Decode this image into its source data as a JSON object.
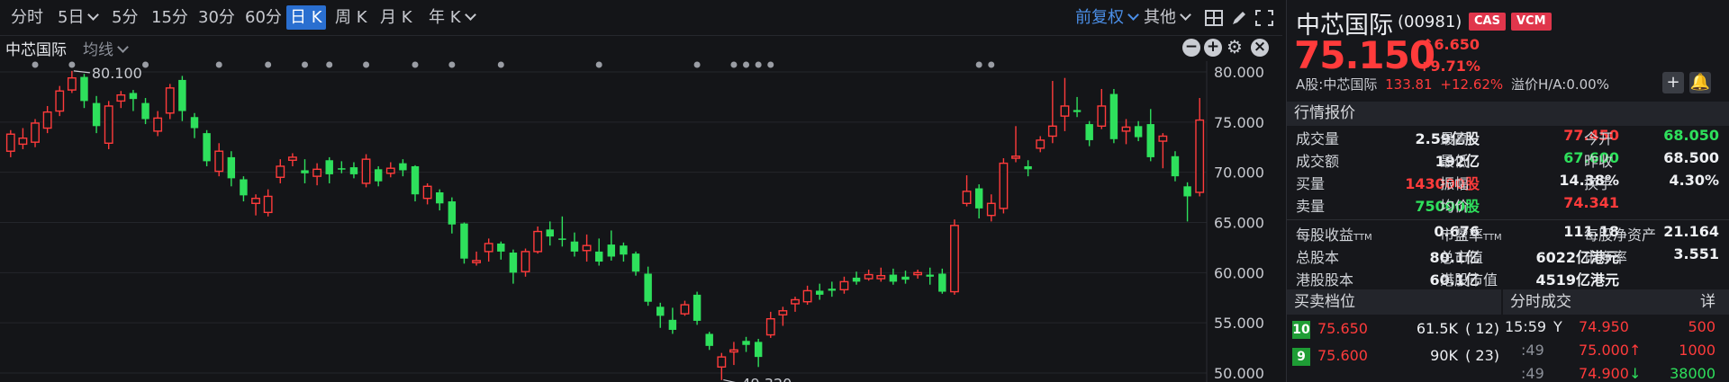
{
  "toolbar": {
    "periods": [
      "分时",
      "5日",
      "5分",
      "15分",
      "30分",
      "60分",
      "日 K",
      "周 K",
      "月 K",
      "年 K"
    ],
    "active_period": "日 K",
    "adjust_label": "前复权",
    "other_label": "其他"
  },
  "subbar": {
    "stock_label": "中芯国际",
    "ma_label": "均线"
  },
  "quote": {
    "name": "中芯国际",
    "code": "(00981)",
    "badges": [
      "CAS",
      "VCM"
    ],
    "price": "75.150",
    "change": "6.650",
    "change_pct": "+9.71%",
    "ashare_label": "A股:中芯国际",
    "ashare_price": "133.81",
    "ashare_pct": "+12.62%",
    "premium_label": "溢价H/A:",
    "premium_value": "0.00%",
    "section_title": "行情报价",
    "stats": [
      {
        "l1": "成交量",
        "v1": "2.59亿股",
        "c1": "white",
        "l2": "最高",
        "v2": "77.450",
        "c2": "red",
        "l3": "今开",
        "v3": "68.050",
        "c3": "green"
      },
      {
        "l1": "成交额",
        "v1": "192亿",
        "c1": "white",
        "l2": "最低",
        "v2": "67.600",
        "c2": "green",
        "l3": "昨收",
        "v3": "68.500",
        "c3": "white"
      },
      {
        "l1": "买量",
        "v1": "143000股",
        "c1": "red",
        "l2": "振幅",
        "v2": "14.38%",
        "c2": "white",
        "l3": "换手",
        "v3": "4.30%",
        "c3": "white"
      },
      {
        "l1": "卖量",
        "v1": "75000股",
        "c1": "green",
        "l2": "均价",
        "v2": "74.341",
        "c2": "red",
        "l3": "",
        "v3": "",
        "c3": "white"
      }
    ],
    "fundamentals": [
      {
        "l1": "每股收益",
        "s1": "TTM",
        "v1": "0.676",
        "l2": "市盈率",
        "s2": "TTM",
        "v2": "111.18",
        "l3": "每股净资产",
        "v3": "21.164"
      },
      {
        "l1": "总股本",
        "s1": "",
        "v1": "80.1亿",
        "l2": "总市值",
        "s2": "",
        "v2": "6022亿港元",
        "l3": "市净率",
        "v3": "3.551"
      },
      {
        "l1": "港股股本",
        "s1": "",
        "v1": "60.1亿",
        "l2": "港股市值",
        "s2": "",
        "v2": "4519亿港元",
        "l3": "",
        "v3": ""
      }
    ]
  },
  "orderbook": {
    "title": "买卖档位",
    "rows": [
      {
        "level": "10",
        "price": "75.650",
        "volume": "61.5K",
        "orders": "( 12)"
      },
      {
        "level": "9",
        "price": "75.600",
        "volume": "90K",
        "orders": "( 23)"
      }
    ]
  },
  "trades": {
    "title": "分时成交",
    "detail_label": "详",
    "rows": [
      {
        "time": "15:59",
        "flag": "Y",
        "price": "74.950",
        "arrow": "",
        "volume": "500",
        "pc": "red",
        "vc": "red"
      },
      {
        "time": ":49",
        "flag": "",
        "price": "75.000",
        "arrow": "↑",
        "volume": "1000",
        "pc": "red",
        "vc": "red"
      },
      {
        "time": ":49",
        "flag": "",
        "price": "74.900",
        "arrow": "↓",
        "volume": "38000",
        "pc": "red",
        "vc": "green"
      }
    ]
  },
  "colors": {
    "up": "#ff3b3b",
    "down": "#2ee05c",
    "accent": "#2a6fd0"
  },
  "chart_data": {
    "type": "candlestick",
    "y_ticks": [
      "80.000",
      "75.000",
      "70.000",
      "65.000",
      "60.000",
      "55.000",
      "50.000"
    ],
    "ylim": [
      49.2,
      80.6
    ],
    "annotations": [
      {
        "label": "80.100",
        "value": 80.1
      },
      {
        "label": "49.320",
        "value": 49.32
      }
    ],
    "candles": [
      [
        72.1,
        73.8,
        74.2,
        71.5
      ],
      [
        72.8,
        73.4,
        74.4,
        72.3
      ],
      [
        73.0,
        74.9,
        75.3,
        72.5
      ],
      [
        74.4,
        76.0,
        76.6,
        73.9
      ],
      [
        76.1,
        78.1,
        78.6,
        75.6
      ],
      [
        78.2,
        79.4,
        80.1,
        77.9
      ],
      [
        79.5,
        77.1,
        79.8,
        76.4
      ],
      [
        76.9,
        74.6,
        77.6,
        73.9
      ],
      [
        72.9,
        76.6,
        77.1,
        72.3
      ],
      [
        77.1,
        77.7,
        78.1,
        76.4
      ],
      [
        77.9,
        77.3,
        78.2,
        76.1
      ],
      [
        76.9,
        75.3,
        77.4,
        74.8
      ],
      [
        74.1,
        75.4,
        76.1,
        73.6
      ],
      [
        75.9,
        78.4,
        78.8,
        75.3
      ],
      [
        79.2,
        76.1,
        79.6,
        75.1
      ],
      [
        75.5,
        74.4,
        75.9,
        73.4
      ],
      [
        73.9,
        71.1,
        74.2,
        70.6
      ],
      [
        70.1,
        72.1,
        72.9,
        69.6
      ],
      [
        71.5,
        69.4,
        72.1,
        68.6
      ],
      [
        69.3,
        67.7,
        69.6,
        67.1
      ],
      [
        66.9,
        67.4,
        67.8,
        65.7
      ],
      [
        66.0,
        67.6,
        68.3,
        65.6
      ],
      [
        69.5,
        70.6,
        71.3,
        68.9
      ],
      [
        71.2,
        71.5,
        71.9,
        70.6
      ],
      [
        70.2,
        69.9,
        71.3,
        68.9
      ],
      [
        69.6,
        70.3,
        70.9,
        68.7
      ],
      [
        71.2,
        69.8,
        71.5,
        68.9
      ],
      [
        70.4,
        70.3,
        71.1,
        69.9
      ],
      [
        70.5,
        69.8,
        71.0,
        69.4
      ],
      [
        68.9,
        71.3,
        71.8,
        68.5
      ],
      [
        70.3,
        69.1,
        70.6,
        68.6
      ],
      [
        69.9,
        70.4,
        71.0,
        69.5
      ],
      [
        70.9,
        70.2,
        71.3,
        69.6
      ],
      [
        70.6,
        67.8,
        70.7,
        67.1
      ],
      [
        67.4,
        68.6,
        68.9,
        66.8
      ],
      [
        68.0,
        66.9,
        68.3,
        66.2
      ],
      [
        67.1,
        64.8,
        67.5,
        63.9
      ],
      [
        64.9,
        61.4,
        65.0,
        60.9
      ],
      [
        61.0,
        61.2,
        62.1,
        60.7
      ],
      [
        62.1,
        62.9,
        63.4,
        61.1
      ],
      [
        62.9,
        62.1,
        63.1,
        61.3
      ],
      [
        62.0,
        60.0,
        62.3,
        58.9
      ],
      [
        60.1,
        62.1,
        62.4,
        59.6
      ],
      [
        62.1,
        64.1,
        64.6,
        61.9
      ],
      [
        64.3,
        63.6,
        65.1,
        62.7
      ],
      [
        63.4,
        63.3,
        65.6,
        62.6
      ],
      [
        63.1,
        62.1,
        64.0,
        61.6
      ],
      [
        62.2,
        62.7,
        63.8,
        61.1
      ],
      [
        62.1,
        61.1,
        63.4,
        60.7
      ],
      [
        62.8,
        61.6,
        64.2,
        61.2
      ],
      [
        62.7,
        61.8,
        63.0,
        61.1
      ],
      [
        61.9,
        60.1,
        62.1,
        59.7
      ],
      [
        59.9,
        57.1,
        60.6,
        56.7
      ],
      [
        56.6,
        55.7,
        57.0,
        54.5
      ],
      [
        55.3,
        54.3,
        56.5,
        53.9
      ],
      [
        55.9,
        56.8,
        57.2,
        55.7
      ],
      [
        57.8,
        55.2,
        58.1,
        54.8
      ],
      [
        53.9,
        52.7,
        54.1,
        52.3
      ],
      [
        50.6,
        51.6,
        52.0,
        49.3
      ],
      [
        52.1,
        52.3,
        53.1,
        50.8
      ],
      [
        53.2,
        52.8,
        53.6,
        52.1
      ],
      [
        53.1,
        51.6,
        53.4,
        50.6
      ],
      [
        53.8,
        55.4,
        56.1,
        53.5
      ],
      [
        55.8,
        56.2,
        56.6,
        54.7
      ],
      [
        56.9,
        57.3,
        57.6,
        56.1
      ],
      [
        57.1,
        58.2,
        58.7,
        56.8
      ],
      [
        58.2,
        57.8,
        58.9,
        57.3
      ],
      [
        58.4,
        58.2,
        59.1,
        57.6
      ],
      [
        58.3,
        59.1,
        59.6,
        57.9
      ],
      [
        59.5,
        59.1,
        60.1,
        58.8
      ],
      [
        59.4,
        59.8,
        60.3,
        59.2
      ],
      [
        59.4,
        59.7,
        60.5,
        59.1
      ],
      [
        59.8,
        59.1,
        60.4,
        58.8
      ],
      [
        59.6,
        59.3,
        60.2,
        58.9
      ],
      [
        59.8,
        60.0,
        60.3,
        59.4
      ],
      [
        59.8,
        59.6,
        60.5,
        58.8
      ],
      [
        59.9,
        58.1,
        60.4,
        57.9
      ],
      [
        58.1,
        64.7,
        65.3,
        57.8
      ],
      [
        66.9,
        68.1,
        69.7,
        66.6
      ],
      [
        68.4,
        66.4,
        68.8,
        65.4
      ],
      [
        65.7,
        66.9,
        67.8,
        65.1
      ],
      [
        66.4,
        70.9,
        71.4,
        65.9
      ],
      [
        71.4,
        71.6,
        74.6,
        71.0
      ],
      [
        70.6,
        70.3,
        71.2,
        69.6
      ],
      [
        72.4,
        73.2,
        73.6,
        72.0
      ],
      [
        73.6,
        74.6,
        79.1,
        72.9
      ],
      [
        75.6,
        76.6,
        79.4,
        74.1
      ],
      [
        76.2,
        76.0,
        77.5,
        75.5
      ],
      [
        74.8,
        73.2,
        75.1,
        72.6
      ],
      [
        74.6,
        76.6,
        78.3,
        74.3
      ],
      [
        77.8,
        73.3,
        78.3,
        72.9
      ],
      [
        74.1,
        74.5,
        75.3,
        72.8
      ],
      [
        74.6,
        73.5,
        75.1,
        73.1
      ],
      [
        74.8,
        71.5,
        76.3,
        71.1
      ],
      [
        73.1,
        73.6,
        73.9,
        70.4
      ],
      [
        71.6,
        69.6,
        72.1,
        69.1
      ],
      [
        68.6,
        67.6,
        69.0,
        65.1
      ],
      [
        68.0,
        75.2,
        77.4,
        67.6
      ]
    ],
    "marker_x_indices": [
      2,
      5,
      11,
      17,
      21,
      24,
      26,
      29,
      33,
      36,
      40,
      48,
      56,
      59,
      60,
      61,
      62,
      79,
      80
    ]
  }
}
